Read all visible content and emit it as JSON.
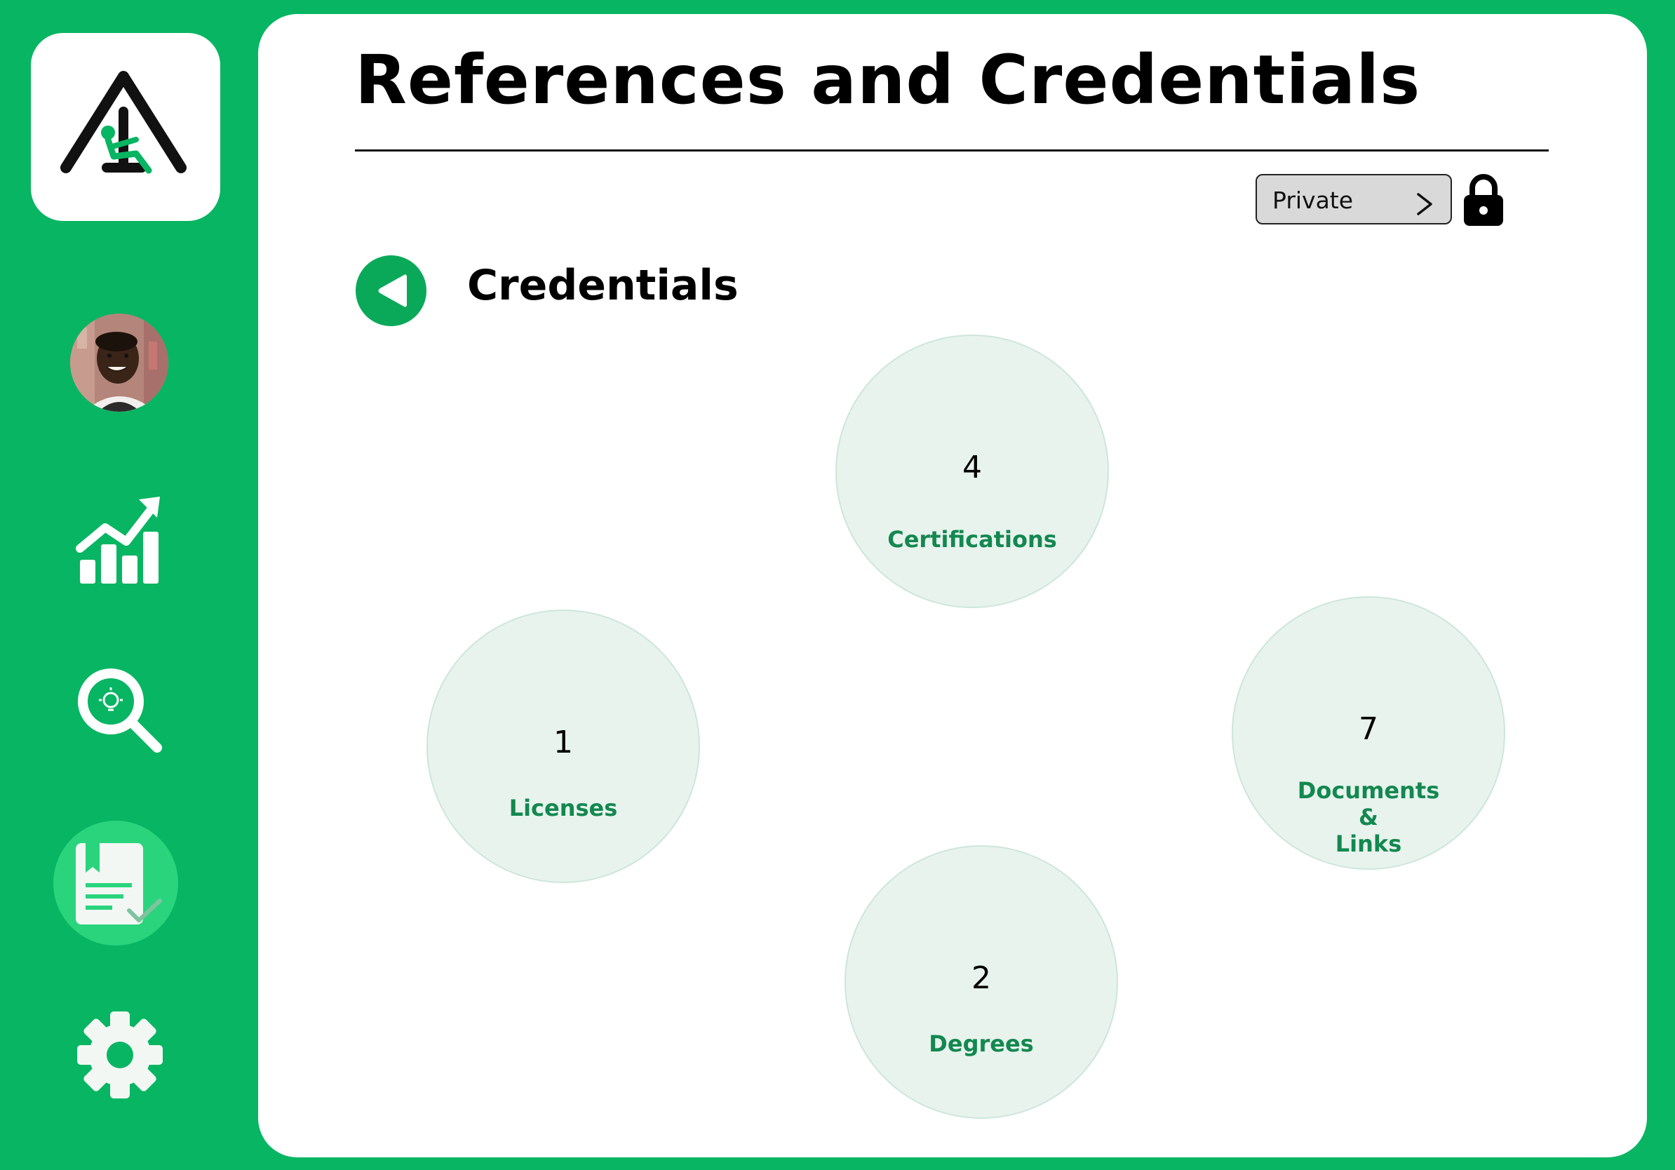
{
  "header": {
    "title": "References and Credentials"
  },
  "privacy": {
    "label": "Private"
  },
  "section": {
    "title": "Credentials"
  },
  "sidebar": {
    "items": [
      {
        "icon": "profile-avatar"
      },
      {
        "icon": "analytics-chart-icon"
      },
      {
        "icon": "search-insight-icon"
      },
      {
        "icon": "credentials-document-icon",
        "active": true
      },
      {
        "icon": "gear-icon"
      }
    ]
  },
  "categories": [
    {
      "count": "4",
      "label": "Certifications"
    },
    {
      "count": "1",
      "label": "Licenses"
    },
    {
      "count": "7",
      "label": "Documents\n&\nLinks"
    },
    {
      "count": "2",
      "label": "Degrees"
    }
  ],
  "colors": {
    "brand_green": "#08b562",
    "active_nav": "#2ad47d",
    "bubble_fill": "#e8f3ee",
    "bubble_label": "#13884f"
  }
}
